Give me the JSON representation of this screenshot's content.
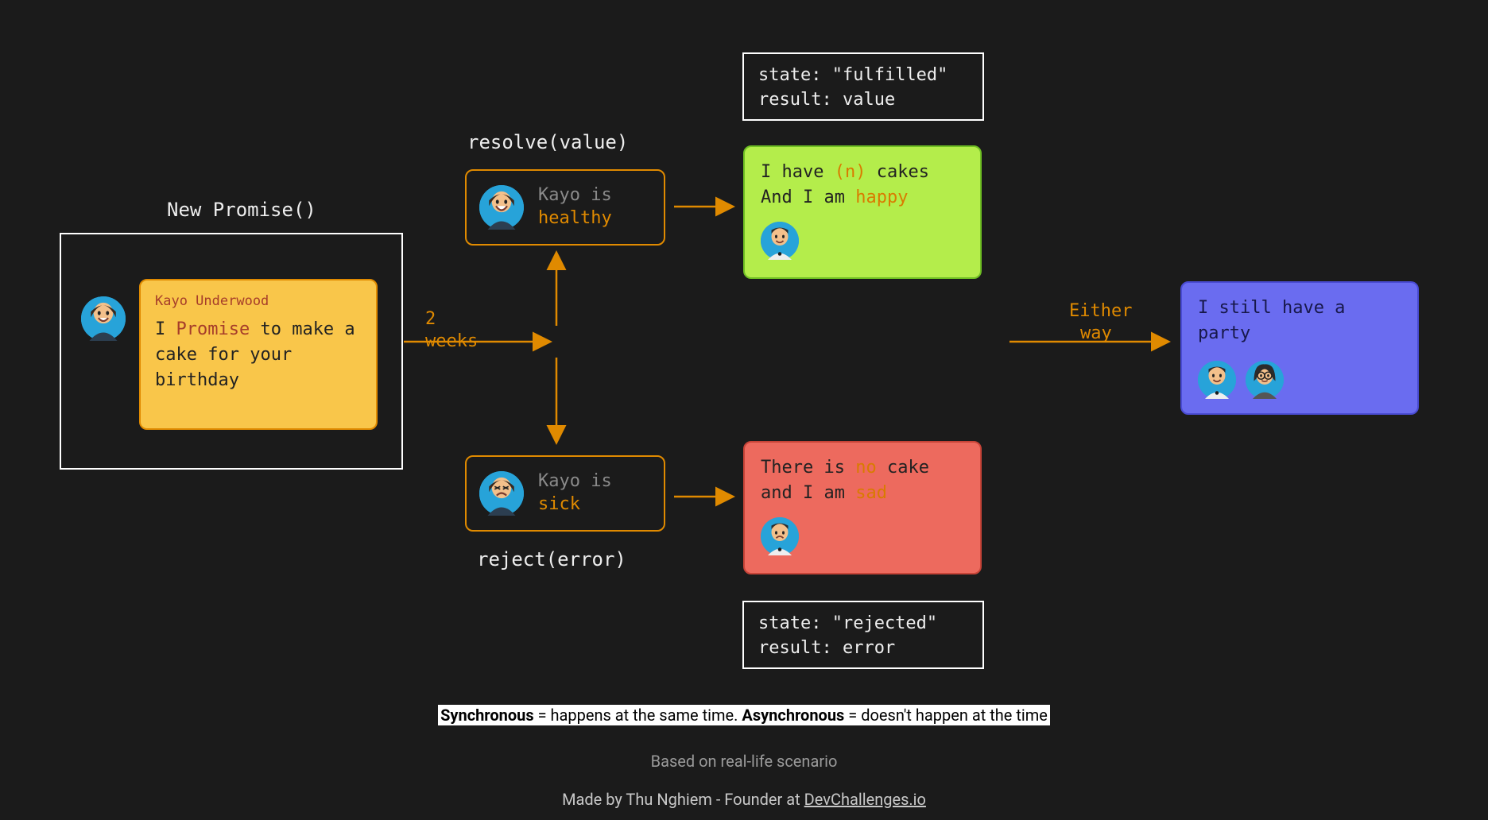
{
  "title": "New Promise()",
  "promise_box": {
    "name": "Kayo Underwood",
    "text_pre": "I ",
    "text_hl": "Promise",
    "text_post": " to make a cake for your birthday"
  },
  "arrow1_label_line1": "2",
  "arrow1_label_line2": "weeks",
  "resolve_label": "resolve(value)",
  "reject_label": "reject(error)",
  "healthy_box": {
    "line1": "Kayo is",
    "line2": "healthy"
  },
  "sick_box": {
    "line1": "Kayo is",
    "line2": "sick"
  },
  "fulfilled_box": {
    "line1": "state: \"fulfilled\"",
    "line2": "result: value"
  },
  "rejected_box": {
    "line1": "state: \"rejected\"",
    "line2": "result: error"
  },
  "happy_box": {
    "line1_pre": "I have ",
    "line1_hl": "(n)",
    "line1_post": " cakes",
    "line2_pre": "And I am ",
    "line2_hl": "happy"
  },
  "sad_box": {
    "line1_pre": "There is ",
    "line1_hl": "no",
    "line1_post": " cake",
    "line2_pre": "and I am ",
    "line2_hl": "sad"
  },
  "either_label_line1": "Either",
  "either_label_line2": "way",
  "party_box": {
    "line1": "I still have a",
    "line2": "party"
  },
  "footer": {
    "sync_strong": "Synchronous",
    "sync_text": " = happens at the same time. ",
    "async_strong": "Asynchronous",
    "async_text": " = doesn't happen at the time",
    "line2": "Based on real-life scenario",
    "line3_pre": "Made by Thu Nghiem - Founder at ",
    "line3_link": "DevChallenges.io"
  }
}
